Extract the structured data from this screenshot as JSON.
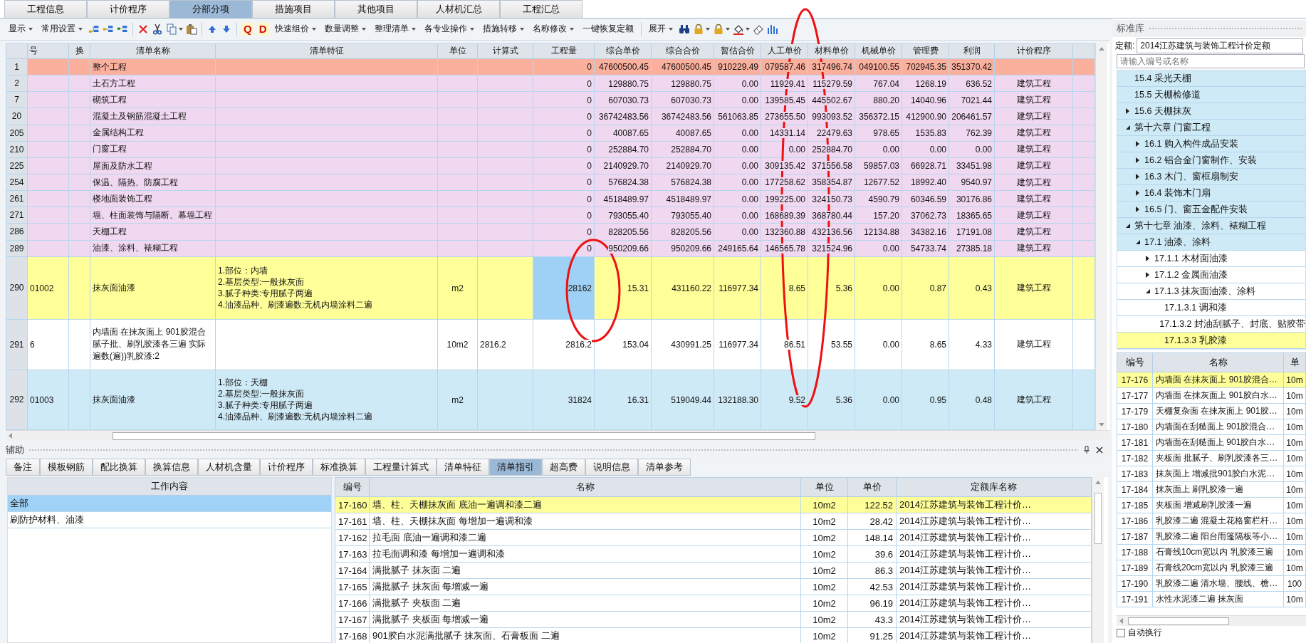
{
  "top_tabs": [
    {
      "label": "工程信息",
      "selected": false
    },
    {
      "label": "计价程序",
      "selected": false
    },
    {
      "label": "分部分项",
      "selected": true
    },
    {
      "label": "措施项目",
      "selected": false
    },
    {
      "label": "其他项目",
      "selected": false
    },
    {
      "label": "人材机汇总",
      "selected": false
    },
    {
      "label": "工程汇总",
      "selected": false
    }
  ],
  "toolbar": {
    "menus_left": [
      {
        "label": "显示",
        "dropdown": true
      },
      {
        "label": "常用设置",
        "dropdown": true
      }
    ],
    "letter_icons": [
      "Q",
      "D"
    ],
    "menus_mid": [
      {
        "label": "快速组价",
        "dropdown": true
      },
      {
        "label": "数量调整",
        "dropdown": true
      },
      {
        "label": "整理清单",
        "dropdown": true
      },
      {
        "label": "各专业操作",
        "dropdown": true
      },
      {
        "label": "措施转移",
        "dropdown": true
      },
      {
        "label": "名称修改",
        "dropdown": true
      },
      {
        "label": "一键恢复定额",
        "dropdown": false
      }
    ],
    "menus_right": [
      {
        "label": "展开",
        "dropdown": true
      }
    ]
  },
  "main_table": {
    "columns": [
      "号",
      "换",
      "清单名称",
      "清单特征",
      "单位",
      "计算式",
      "工程量",
      "综合单价",
      "综合合价",
      "暂估合价",
      "人工单价",
      "材料单价",
      "机械单价",
      "管理费",
      "利润",
      "计价程序"
    ],
    "rows": [
      {
        "no": "1",
        "kind": "project",
        "selected": false,
        "quantity_focused": false,
        "name": "整个工程",
        "quantity": "0",
        "unit_price": "47600500.45",
        "total": "47600500.45",
        "provisional": "910229.49",
        "labor": "079587.46",
        "material": "317496.74",
        "machine": "049100.55",
        "management": "702945.35",
        "profit": "351370.42"
      },
      {
        "no": "2",
        "kind": "section",
        "selected": false,
        "quantity_focused": false,
        "name": "土石方工程",
        "quantity": "0",
        "unit_price": "129880.75",
        "total": "129880.75",
        "provisional": "0.00",
        "labor": "11929.41",
        "material": "115279.59",
        "machine": "767.04",
        "management": "1268.19",
        "profit": "636.52",
        "program": "建筑工程"
      },
      {
        "no": "7",
        "kind": "section",
        "selected": false,
        "quantity_focused": false,
        "name": "砌筑工程",
        "quantity": "0",
        "unit_price": "607030.73",
        "total": "607030.73",
        "provisional": "0.00",
        "labor": "139585.45",
        "material": "445502.67",
        "machine": "880.20",
        "management": "14040.96",
        "profit": "7021.44",
        "program": "建筑工程"
      },
      {
        "no": "20",
        "kind": "section",
        "selected": false,
        "quantity_focused": false,
        "name": "混凝土及钢筋混凝土工程",
        "quantity": "0",
        "unit_price": "36742483.56",
        "total": "36742483.56",
        "provisional": "561063.85",
        "labor": "273655.50",
        "material": "993093.52",
        "machine": "356372.15",
        "management": "412900.90",
        "profit": "206461.57",
        "program": "建筑工程"
      },
      {
        "no": "205",
        "kind": "section",
        "selected": false,
        "quantity_focused": false,
        "name": "金属结构工程",
        "quantity": "0",
        "unit_price": "40087.65",
        "total": "40087.65",
        "provisional": "0.00",
        "labor": "14331.14",
        "material": "22479.63",
        "machine": "978.65",
        "management": "1535.83",
        "profit": "762.39",
        "program": "建筑工程"
      },
      {
        "no": "210",
        "kind": "section",
        "selected": false,
        "quantity_focused": false,
        "name": "门窗工程",
        "quantity": "0",
        "unit_price": "252884.70",
        "total": "252884.70",
        "provisional": "0.00",
        "labor": "0.00",
        "material": "252884.70",
        "machine": "0.00",
        "management": "0.00",
        "profit": "0.00",
        "program": "建筑工程"
      },
      {
        "no": "225",
        "kind": "section",
        "selected": false,
        "quantity_focused": false,
        "name": "屋面及防水工程",
        "quantity": "0",
        "unit_price": "2140929.70",
        "total": "2140929.70",
        "provisional": "0.00",
        "labor": "309135.42",
        "material": "371556.58",
        "machine": "59857.03",
        "management": "66928.71",
        "profit": "33451.98",
        "program": "建筑工程"
      },
      {
        "no": "254",
        "kind": "section",
        "selected": false,
        "quantity_focused": false,
        "name": "保温、隔热、防腐工程",
        "quantity": "0",
        "unit_price": "576824.38",
        "total": "576824.38",
        "provisional": "0.00",
        "labor": "177258.62",
        "material": "358354.87",
        "machine": "12677.52",
        "management": "18992.40",
        "profit": "9540.97",
        "program": "建筑工程"
      },
      {
        "no": "261",
        "kind": "section",
        "selected": false,
        "quantity_focused": false,
        "name": "楼地面装饰工程",
        "quantity": "0",
        "unit_price": "4518489.97",
        "total": "4518489.97",
        "provisional": "0.00",
        "labor": "199225.00",
        "material": "324150.73",
        "machine": "4590.79",
        "management": "60346.59",
        "profit": "30176.86",
        "program": "建筑工程"
      },
      {
        "no": "271",
        "kind": "section",
        "selected": false,
        "quantity_focused": false,
        "name": "墙、柱面装饰与隔断、幕墙工程",
        "quantity": "0",
        "unit_price": "793055.40",
        "total": "793055.40",
        "provisional": "0.00",
        "labor": "168689.39",
        "material": "368780.44",
        "machine": "157.20",
        "management": "37062.73",
        "profit": "18365.65",
        "program": "建筑工程"
      },
      {
        "no": "286",
        "kind": "section",
        "selected": false,
        "quantity_focused": false,
        "name": "天棚工程",
        "quantity": "0",
        "unit_price": "828205.56",
        "total": "828205.56",
        "provisional": "0.00",
        "labor": "132360.88",
        "material": "432136.56",
        "machine": "12134.88",
        "management": "34382.16",
        "profit": "17191.08",
        "program": "建筑工程"
      },
      {
        "no": "289",
        "kind": "section",
        "selected": false,
        "quantity_focused": false,
        "name": "油漆、涂料、裱糊工程",
        "quantity": "0",
        "unit_price": "950209.66",
        "total": "950209.66",
        "provisional": "249165.64",
        "labor": "146565.78",
        "material": "321524.96",
        "machine": "0.00",
        "management": "54733.74",
        "profit": "27385.18",
        "program": "建筑工程"
      },
      {
        "no": "290",
        "kind": "item",
        "selected": true,
        "quantity_focused": true,
        "code": "01002",
        "name": "抹灰面油漆",
        "features": "1.部位：内墙\n2.基层类型:一般抹灰面\n3.腻子种类:专用腻子两遍\n4.油漆品种、刷漆遍数:无机内墙涂料二遍",
        "unit": "m2",
        "quantity": "28162",
        "unit_price": "15.31",
        "total": "431160.22",
        "provisional": "116977.34",
        "labor": "8.65",
        "material": "5.36",
        "machine": "0.00",
        "management": "0.87",
        "profit": "0.43",
        "program": "建筑工程"
      },
      {
        "no": "291",
        "kind": "quota",
        "selected": false,
        "quantity_focused": false,
        "code": "6",
        "name": "内墙面 在抹灰面上 901胶混合腻子批、刷乳胶漆各三遍 实际遍数(遍))乳胶漆:2",
        "unit": "10m2",
        "formula": "2816.2",
        "quantity": "2816.2",
        "unit_price": "153.04",
        "total": "430991.25",
        "provisional": "116977.34",
        "labor": "86.51",
        "material": "53.55",
        "machine": "0.00",
        "management": "8.65",
        "profit": "4.33",
        "program": "建筑工程"
      },
      {
        "no": "292",
        "kind": "item",
        "selected": false,
        "quantity_focused": false,
        "code": "01003",
        "name": "抹灰面油漆",
        "features": "1.部位：天棚\n2.基层类型:一般抹灰面\n3.腻子种类:专用腻子两遍\n4.油漆品种、刷漆遍数:无机内墙涂料二遍",
        "unit": "m2",
        "quantity": "31824",
        "unit_price": "16.31",
        "total": "519049.44",
        "provisional": "132188.30",
        "labor": "9.52",
        "material": "5.36",
        "machine": "0.00",
        "management": "0.95",
        "profit": "0.48",
        "program": "建筑工程"
      }
    ]
  },
  "aux_panel": {
    "title": "辅助",
    "tabs": [
      {
        "label": "备注",
        "selected": false
      },
      {
        "label": "模板钢筋",
        "selected": false
      },
      {
        "label": "配比换算",
        "selected": false
      },
      {
        "label": "换算信息",
        "selected": false
      },
      {
        "label": "人材机含量",
        "selected": false
      },
      {
        "label": "计价程序",
        "selected": false
      },
      {
        "label": "标准换算",
        "selected": false
      },
      {
        "label": "工程量计算式",
        "selected": false
      },
      {
        "label": "清单特征",
        "selected": false
      },
      {
        "label": "清单指引",
        "selected": true
      },
      {
        "label": "超高费",
        "selected": false
      },
      {
        "label": "说明信息",
        "selected": false
      },
      {
        "label": "清单参考",
        "selected": false
      }
    ],
    "work_content": {
      "header": "工作内容",
      "items": [
        {
          "label": "全部",
          "selected": true
        },
        {
          "label": "刷防护材料、油漆",
          "selected": false
        }
      ]
    },
    "quota_table": {
      "columns": [
        "编号",
        "名称",
        "单位",
        "单价",
        "定额库名称"
      ],
      "rows": [
        {
          "code": "17-160",
          "name": "墙、柱、天棚抹灰面 底油一遍调和漆二遍",
          "unit": "10m2",
          "price": "122.52",
          "library": "2014江苏建筑与装饰工程计价…",
          "selected": true
        },
        {
          "code": "17-161",
          "name": "墙、柱、天棚抹灰面 每增加一遍调和漆",
          "unit": "10m2",
          "price": "28.42",
          "library": "2014江苏建筑与装饰工程计价…",
          "selected": false
        },
        {
          "code": "17-162",
          "name": "拉毛面 底油一遍调和漆二遍",
          "unit": "10m2",
          "price": "148.14",
          "library": "2014江苏建筑与装饰工程计价…",
          "selected": false
        },
        {
          "code": "17-163",
          "name": "拉毛面调和漆 每增加一遍调和漆",
          "unit": "10m2",
          "price": "39.6",
          "library": "2014江苏建筑与装饰工程计价…",
          "selected": false
        },
        {
          "code": "17-164",
          "name": "满批腻子 抹灰面 二遍",
          "unit": "10m2",
          "price": "86.3",
          "library": "2014江苏建筑与装饰工程计价…",
          "selected": false
        },
        {
          "code": "17-165",
          "name": "满批腻子 抹灰面 每增减一遍",
          "unit": "10m2",
          "price": "42.53",
          "library": "2014江苏建筑与装饰工程计价…",
          "selected": false
        },
        {
          "code": "17-166",
          "name": "满批腻子 夹板面 二遍",
          "unit": "10m2",
          "price": "96.19",
          "library": "2014江苏建筑与装饰工程计价…",
          "selected": false
        },
        {
          "code": "17-167",
          "name": "满批腻子 夹板面 每增减一遍",
          "unit": "10m2",
          "price": "43.3",
          "library": "2014江苏建筑与装饰工程计价…",
          "selected": false
        },
        {
          "code": "17-168",
          "name": "901胶白水泥满批腻子 抹灰面、石膏板面 二遍",
          "unit": "10m2",
          "price": "91.25",
          "library": "2014江苏建筑与装饰工程计价…",
          "selected": false
        }
      ]
    }
  },
  "right_panel": {
    "title": "标准库",
    "quota_label": "定额:",
    "quota_value": "2014江苏建筑与装饰工程计价定额",
    "search": {
      "placeholder": "请输入编号或名称"
    },
    "tree": [
      {
        "label": "15.4 采光天棚",
        "selected": false
      },
      {
        "label": "15.5 天棚检修道",
        "selected": false
      },
      {
        "label": "15.6 天棚抹灰",
        "expanded": false,
        "selected": false
      },
      {
        "label": "第十六章 门窗工程",
        "expanded": true,
        "selected": false,
        "children": [
          {
            "label": "16.1 购入构件成品安装",
            "expanded": false,
            "selected": false
          },
          {
            "label": "16.2 铝合金门窗制作、安装",
            "expanded": false,
            "selected": false
          },
          {
            "label": "16.3 木门、窗框扇制安",
            "expanded": false,
            "selected": false
          },
          {
            "label": "16.4 装饰木门扇",
            "expanded": false,
            "selected": false
          },
          {
            "label": "16.5 门、窗五金配件安装",
            "expanded": false,
            "selected": false
          }
        ]
      },
      {
        "label": "第十七章 油漆、涂料、裱糊工程",
        "expanded": true,
        "selected": false,
        "children": [
          {
            "label": "17.1 油漆、涂料",
            "expanded": true,
            "selected": false,
            "children": [
              {
                "label": "17.1.1 木材面油漆",
                "expanded": false,
                "selected": false
              },
              {
                "label": "17.1.2 金属面油漆",
                "expanded": false,
                "selected": false
              },
              {
                "label": "17.1.3 抹灰面油漆、涂料",
                "expanded": true,
                "selected": false,
                "children": [
                  {
                    "label": "17.1.3.1 调和漆",
                    "selected": false
                  },
                  {
                    "label": "17.1.3.2 封油刮腻子、封底、贴胶带",
                    "selected": false
                  },
                  {
                    "label": "17.1.3.3 乳胶漆",
                    "selected": true
                  }
                ]
              }
            ]
          }
        ]
      }
    ],
    "table": {
      "columns": [
        "编号",
        "名称",
        "单"
      ],
      "rows": [
        {
          "code": "17-176",
          "name": "内墙面 在抹灰面上 901胶混合…",
          "unit": "10m",
          "selected": true
        },
        {
          "code": "17-177",
          "name": "内墙面 在抹灰面上 901胶白水…",
          "unit": "10m",
          "selected": false
        },
        {
          "code": "17-179",
          "name": "天棚复杂面 在抹灰面上 901胶…",
          "unit": "10m",
          "selected": false
        },
        {
          "code": "17-180",
          "name": "内墙面在刮糙面上 901胶混合…",
          "unit": "10m",
          "selected": false
        },
        {
          "code": "17-181",
          "name": "内墙面在刮糙面上 901胶白水…",
          "unit": "10m",
          "selected": false
        },
        {
          "code": "17-182",
          "name": "夹板面 批腻子、刷乳胶漆各三…",
          "unit": "10m",
          "selected": false
        },
        {
          "code": "17-183",
          "name": "抹灰面上 增减批901胶白水泥…",
          "unit": "10m",
          "selected": false
        },
        {
          "code": "17-184",
          "name": "抹灰面上 刷乳胶漆一遍",
          "unit": "10m",
          "selected": false
        },
        {
          "code": "17-185",
          "name": "夹板面 增减刷乳胶漆一遍",
          "unit": "10m",
          "selected": false
        },
        {
          "code": "17-186",
          "name": "乳胶漆二遍 混凝土花格窗栏杆…",
          "unit": "10m",
          "selected": false
        },
        {
          "code": "17-187",
          "name": "乳胶漆二遍 阳台雨篷隔板等小…",
          "unit": "10m",
          "selected": false
        },
        {
          "code": "17-188",
          "name": "石膏线10cm宽以内 乳胶漆三遍",
          "unit": "10m",
          "selected": false
        },
        {
          "code": "17-189",
          "name": "石膏线20cm宽以内 乳胶漆三遍",
          "unit": "10m",
          "selected": false
        },
        {
          "code": "17-190",
          "name": "乳胶漆二遍 清水墙、腰线、檐…",
          "unit": "100",
          "selected": false
        },
        {
          "code": "17-191",
          "name": "水性水泥漆二遍 抹灰面",
          "unit": "10m",
          "selected": false
        }
      ]
    },
    "auto_wrap": {
      "label": "自动换行",
      "checked": false
    }
  }
}
